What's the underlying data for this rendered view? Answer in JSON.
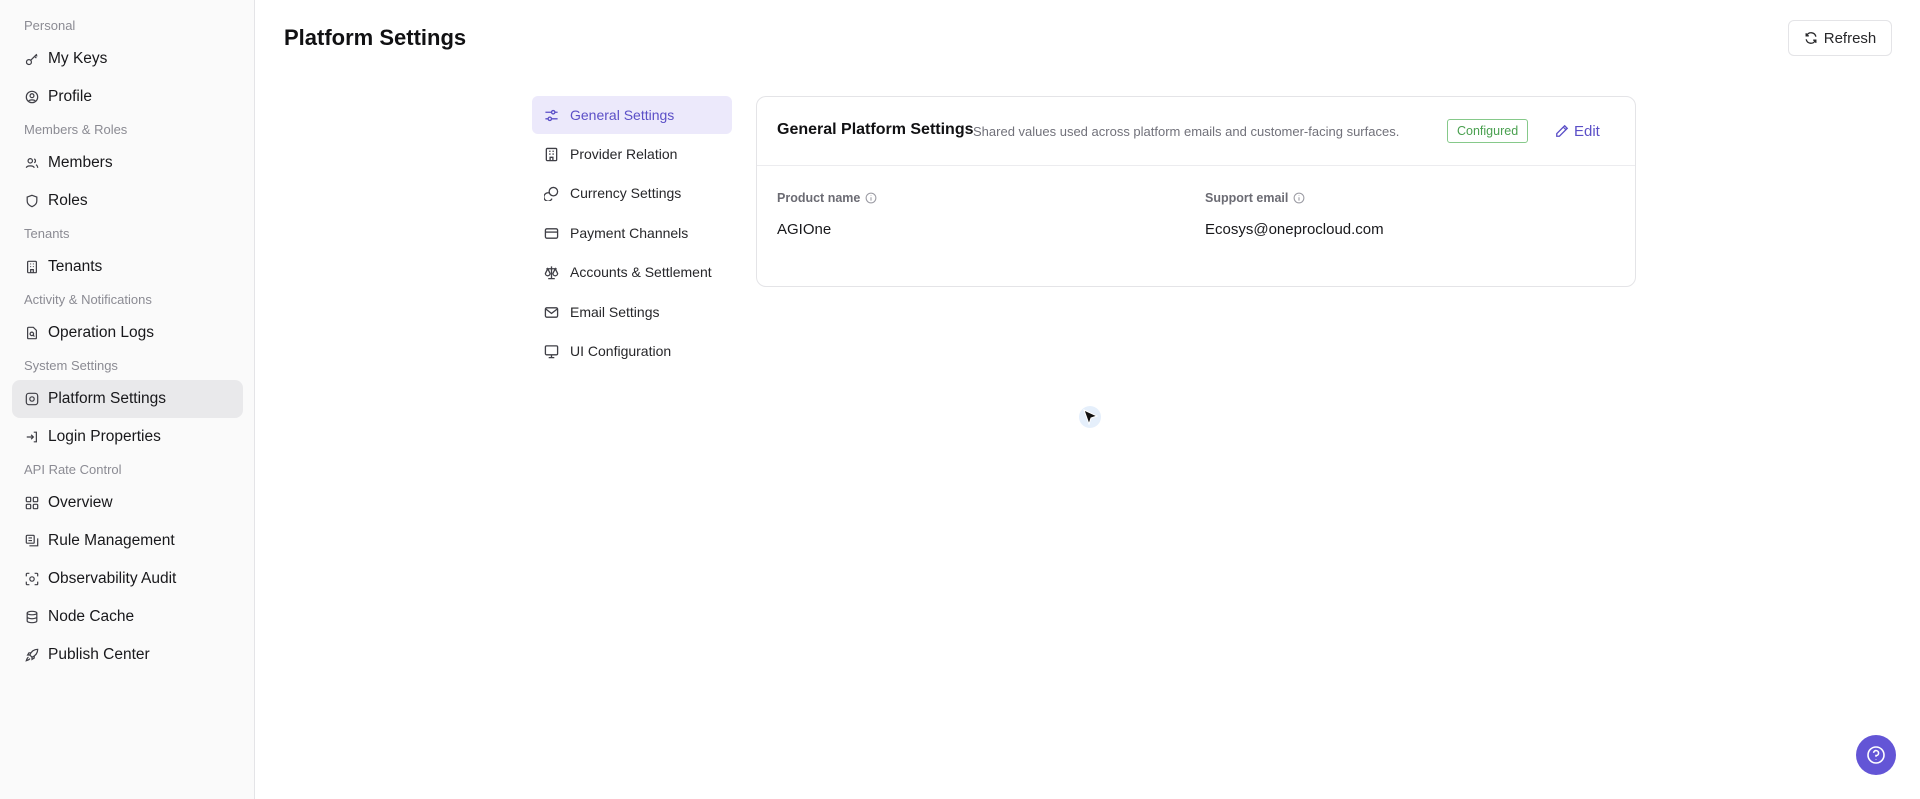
{
  "sidebar": {
    "groups": [
      "Personal",
      "Members & Roles",
      "Tenants",
      "Activity & Notifications",
      "System Settings",
      "API Rate Control"
    ],
    "items": [
      {
        "label": "My Keys",
        "icon": "key-icon"
      },
      {
        "label": "Profile",
        "icon": "user-circle-icon"
      },
      {
        "label": "Members",
        "icon": "users-icon"
      },
      {
        "label": "Roles",
        "icon": "shield-icon"
      },
      {
        "label": "Tenants",
        "icon": "building-icon"
      },
      {
        "label": "Operation Logs",
        "icon": "file-search-icon"
      },
      {
        "label": "Platform Settings",
        "icon": "settings-frame-icon",
        "active": true
      },
      {
        "label": "Login Properties",
        "icon": "login-icon"
      },
      {
        "label": "Overview",
        "icon": "grid-icon"
      },
      {
        "label": "Rule Management",
        "icon": "rules-icon"
      },
      {
        "label": "Observability Audit",
        "icon": "scan-icon"
      },
      {
        "label": "Node Cache",
        "icon": "database-icon"
      },
      {
        "label": "Publish Center",
        "icon": "rocket-icon"
      }
    ]
  },
  "header": {
    "title": "Platform Settings",
    "refresh_label": "Refresh"
  },
  "subnav": {
    "items": [
      {
        "label": "General Settings",
        "icon": "sliders-icon",
        "active": true
      },
      {
        "label": "Provider Relation",
        "icon": "building-icon"
      },
      {
        "label": "Currency Settings",
        "icon": "coins-icon"
      },
      {
        "label": "Payment Channels",
        "icon": "credit-card-icon"
      },
      {
        "label": "Accounts & Settlement",
        "icon": "scale-icon"
      },
      {
        "label": "Email Settings",
        "icon": "mail-icon"
      },
      {
        "label": "UI Configuration",
        "icon": "monitor-icon"
      }
    ]
  },
  "card": {
    "title": "General Platform Settings",
    "subtitle": "Shared values used across platform emails and customer-facing surfaces.",
    "status": "Configured",
    "edit_label": "Edit",
    "fields": [
      {
        "label": "Product name",
        "value": "AGIOne"
      },
      {
        "label": "Support email",
        "value": "Ecosys@oneprocloud.com"
      }
    ]
  },
  "colors": {
    "accent": "#5b4fc7",
    "active_bg": "#ece9fb",
    "status_green": "#49a04f",
    "help_button": "#6355d6"
  }
}
